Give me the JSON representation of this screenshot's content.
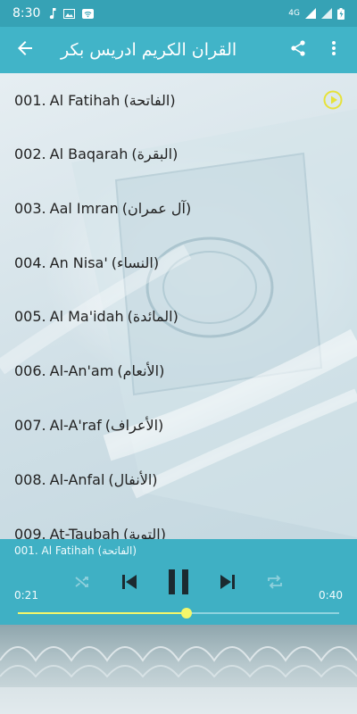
{
  "status": {
    "time": "8:30",
    "network": "4G"
  },
  "appbar": {
    "title": "القران الكريم ادريس بكر"
  },
  "tracks": [
    {
      "num": "001.",
      "name": "Al Fatihah",
      "ar": "(الفاتحة)"
    },
    {
      "num": "002.",
      "name": "Al Baqarah",
      "ar": "(البقرة)"
    },
    {
      "num": "003.",
      "name": "Aal Imran",
      "ar": "(آل عمران)"
    },
    {
      "num": "004.",
      "name": "An Nisa'",
      "ar": "(النساء)"
    },
    {
      "num": "005.",
      "name": "Al Ma'idah",
      "ar": "(المائدة)"
    },
    {
      "num": "006.",
      "name": "Al-An'am",
      "ar": "(الأنعام)"
    },
    {
      "num": "007.",
      "name": "Al-A'raf",
      "ar": "(الأعراف)"
    },
    {
      "num": "008.",
      "name": "Al-Anfal",
      "ar": "(الأنفال)"
    },
    {
      "num": "009.",
      "name": "At-Taubah",
      "ar": "(التوبة)"
    }
  ],
  "player": {
    "now_playing": "001. Al Fatihah (الفاتحة)",
    "elapsed": "0:21",
    "duration": "0:40",
    "progress_fraction": 0.525
  },
  "colors": {
    "statusbar": "#36a2b5",
    "appbar": "#41b4c8",
    "player": "#3fb0c4",
    "accent": "#f4f76a"
  },
  "icons": [
    "back-arrow-icon",
    "share-icon",
    "more-vert-icon",
    "play-circle-icon",
    "shuffle-icon",
    "skip-previous-icon",
    "pause-icon",
    "skip-next-icon",
    "repeat-icon"
  ]
}
